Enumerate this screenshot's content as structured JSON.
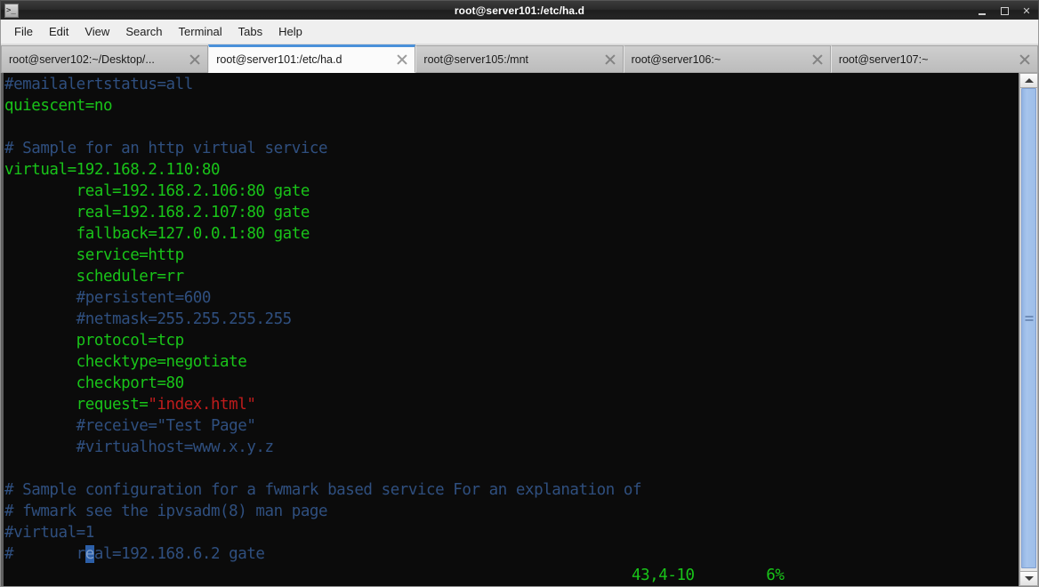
{
  "window": {
    "title": "root@server101:/etc/ha.d",
    "icon": "terminal-icon",
    "controls": [
      {
        "name": "minimize-button",
        "label": "–"
      },
      {
        "name": "maximize-button",
        "label": "□"
      },
      {
        "name": "close-button",
        "label": "✕"
      }
    ]
  },
  "menubar": {
    "items": [
      {
        "label": "File"
      },
      {
        "label": "Edit"
      },
      {
        "label": "View"
      },
      {
        "label": "Search"
      },
      {
        "label": "Terminal"
      },
      {
        "label": "Tabs"
      },
      {
        "label": "Help"
      }
    ]
  },
  "tabs": [
    {
      "label": "root@server102:~/Desktop/...",
      "active": false
    },
    {
      "label": "root@server101:/etc/ha.d",
      "active": true
    },
    {
      "label": "root@server105:/mnt",
      "active": false
    },
    {
      "label": "root@server106:~",
      "active": false
    },
    {
      "label": "root@server107:~",
      "active": false
    }
  ],
  "terminal": {
    "colors": {
      "background": "#0b0b0b",
      "comment": "#2f4f7f",
      "normal": "#19c419",
      "string": "#c01c1c",
      "cursor_bg": "#2c5fa8",
      "cursor_fg": "#7f9ec9"
    },
    "lines": [
      {
        "segments": [
          {
            "text": "#emailalertstatus=all",
            "style": "comment"
          }
        ]
      },
      {
        "segments": [
          {
            "text": "quiescent=no",
            "style": "normal"
          }
        ]
      },
      {
        "segments": [
          {
            "text": "",
            "style": "normal"
          }
        ]
      },
      {
        "segments": [
          {
            "text": "# Sample for an http virtual service",
            "style": "comment"
          }
        ]
      },
      {
        "segments": [
          {
            "text": "virtual=192.168.2.110:80",
            "style": "normal"
          }
        ]
      },
      {
        "segments": [
          {
            "text": "        real=192.168.2.106:80 gate",
            "style": "normal"
          }
        ]
      },
      {
        "segments": [
          {
            "text": "        real=192.168.2.107:80 gate",
            "style": "normal"
          }
        ]
      },
      {
        "segments": [
          {
            "text": "        fallback=127.0.0.1:80 gate",
            "style": "normal"
          }
        ]
      },
      {
        "segments": [
          {
            "text": "        service=http",
            "style": "normal"
          }
        ]
      },
      {
        "segments": [
          {
            "text": "        scheduler=rr",
            "style": "normal"
          }
        ]
      },
      {
        "segments": [
          {
            "text": "        #persistent=600",
            "style": "comment"
          }
        ]
      },
      {
        "segments": [
          {
            "text": "        #netmask=255.255.255.255",
            "style": "comment"
          }
        ]
      },
      {
        "segments": [
          {
            "text": "        protocol=tcp",
            "style": "normal"
          }
        ]
      },
      {
        "segments": [
          {
            "text": "        checktype=negotiate",
            "style": "normal"
          }
        ]
      },
      {
        "segments": [
          {
            "text": "        checkport=80",
            "style": "normal"
          }
        ]
      },
      {
        "segments": [
          {
            "text": "        request=",
            "style": "normal"
          },
          {
            "text": "\"index.html\"",
            "style": "string"
          }
        ]
      },
      {
        "segments": [
          {
            "text": "        #receive=\"Test Page\"",
            "style": "comment"
          }
        ]
      },
      {
        "segments": [
          {
            "text": "        #virtualhost=www.x.y.z",
            "style": "comment"
          }
        ]
      },
      {
        "segments": [
          {
            "text": "",
            "style": "normal"
          }
        ]
      },
      {
        "segments": [
          {
            "text": "# Sample configuration for a fwmark based service For an explanation of",
            "style": "comment"
          }
        ]
      },
      {
        "segments": [
          {
            "text": "# fwmark see the ipvsadm(8) man page",
            "style": "comment"
          }
        ]
      },
      {
        "segments": [
          {
            "text": "#virtual=1",
            "style": "comment"
          }
        ]
      },
      {
        "segments": [
          {
            "text": "#       r",
            "style": "comment"
          },
          {
            "text": "e",
            "style": "cursor"
          },
          {
            "text": "al=192.168.6.2 gate",
            "style": "comment"
          }
        ]
      }
    ],
    "status": {
      "position": "43,4-10",
      "percent": "6%"
    }
  },
  "scrollbar": {
    "up_arrow": "scroll-up-icon",
    "down_arrow": "scroll-down-icon",
    "thumb": "scroll-thumb"
  }
}
